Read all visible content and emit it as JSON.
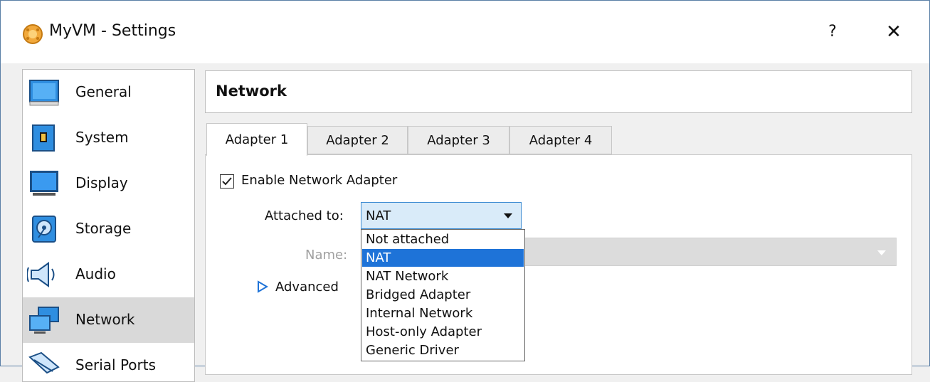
{
  "window": {
    "title": "MyVM - Settings",
    "help": "?",
    "close": "✕"
  },
  "sidebar": {
    "items": [
      {
        "label": "General",
        "icon": "general-icon"
      },
      {
        "label": "System",
        "icon": "system-icon"
      },
      {
        "label": "Display",
        "icon": "display-icon"
      },
      {
        "label": "Storage",
        "icon": "storage-icon"
      },
      {
        "label": "Audio",
        "icon": "audio-icon"
      },
      {
        "label": "Network",
        "icon": "network-icon",
        "selected": true
      },
      {
        "label": "Serial Ports",
        "icon": "serial-ports-icon"
      }
    ]
  },
  "main": {
    "header": "Network",
    "tabs": [
      "Adapter 1",
      "Adapter 2",
      "Adapter 3",
      "Adapter 4"
    ],
    "active_tab": "Adapter 1",
    "enable_label": "Enable Network Adapter",
    "enable_checked": true,
    "attached_label": "Attached to:",
    "attached_value": "NAT",
    "name_label": "Name:",
    "advanced_label": "Advanced"
  },
  "dropdown": {
    "options": [
      "Not attached",
      "NAT",
      "NAT Network",
      "Bridged Adapter",
      "Internal Network",
      "Host-only Adapter",
      "Generic Driver"
    ],
    "selected": "NAT"
  },
  "colors": {
    "accent": "#1e73d8",
    "combo_bg": "#d9ebf9",
    "selected_sidebar": "#d9d9d9"
  }
}
